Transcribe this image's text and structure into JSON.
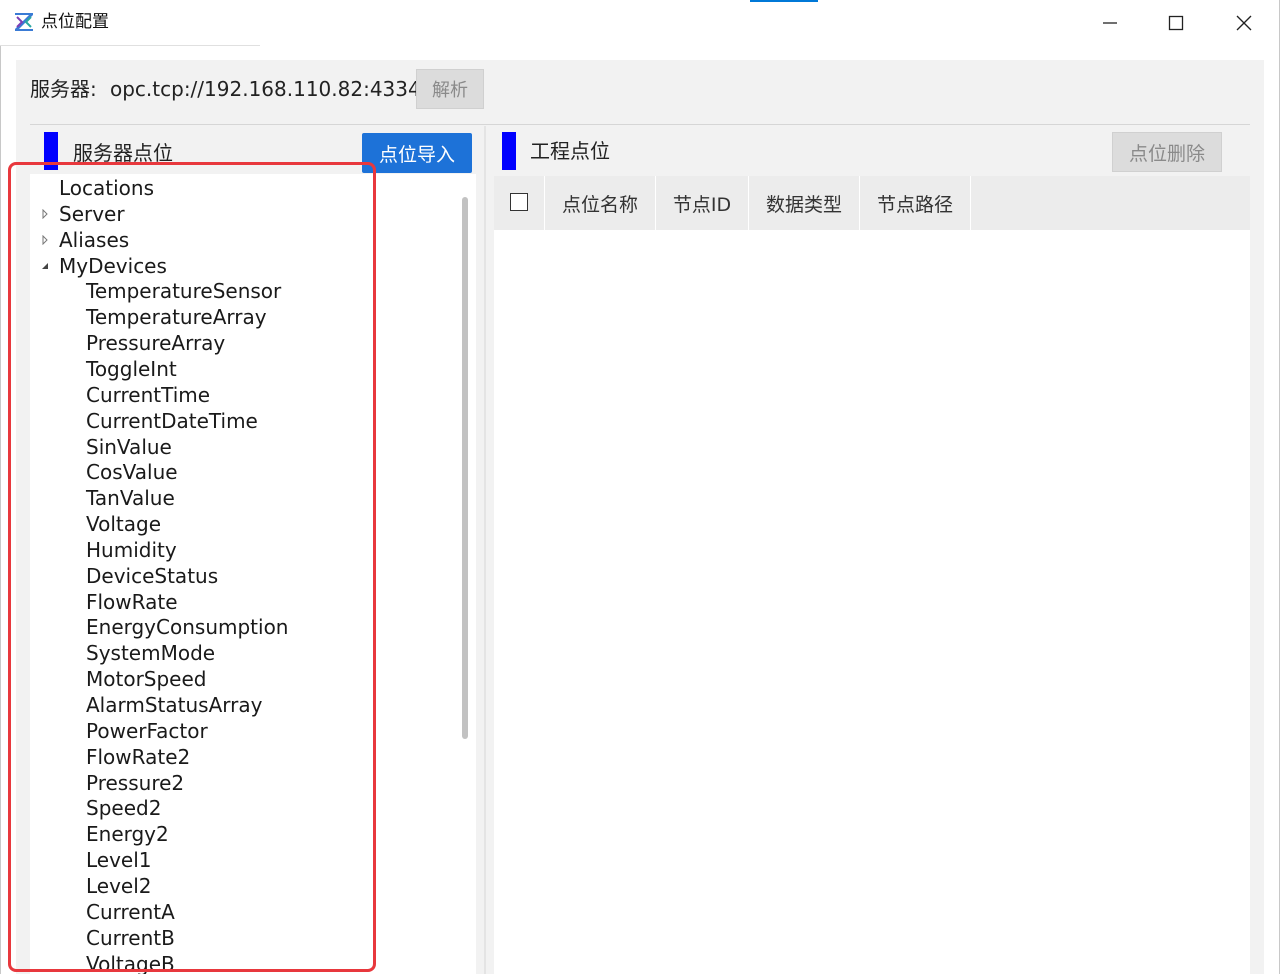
{
  "window": {
    "title": "点位配置",
    "icons": {
      "app": "app-logo-icon",
      "minimize": "minimize-icon",
      "maximize": "maximize-icon",
      "close": "close-icon"
    }
  },
  "server": {
    "label": "服务器:",
    "url": "opc.tcp://192.168.110.82:4334",
    "parse_button": "解析"
  },
  "left_panel": {
    "title": "服务器点位",
    "import_button": "点位导入",
    "tree": [
      {
        "label": "Locations",
        "level": 0,
        "arrow": "none"
      },
      {
        "label": "Server",
        "level": 0,
        "arrow": "collapsed"
      },
      {
        "label": "Aliases",
        "level": 0,
        "arrow": "collapsed"
      },
      {
        "label": "MyDevices",
        "level": 0,
        "arrow": "expanded"
      },
      {
        "label": "TemperatureSensor",
        "level": 1,
        "arrow": "none"
      },
      {
        "label": "TemperatureArray",
        "level": 1,
        "arrow": "none"
      },
      {
        "label": "PressureArray",
        "level": 1,
        "arrow": "none"
      },
      {
        "label": "ToggleInt",
        "level": 1,
        "arrow": "none"
      },
      {
        "label": "CurrentTime",
        "level": 1,
        "arrow": "none"
      },
      {
        "label": "CurrentDateTime",
        "level": 1,
        "arrow": "none"
      },
      {
        "label": "SinValue",
        "level": 1,
        "arrow": "none"
      },
      {
        "label": "CosValue",
        "level": 1,
        "arrow": "none"
      },
      {
        "label": "TanValue",
        "level": 1,
        "arrow": "none"
      },
      {
        "label": "Voltage",
        "level": 1,
        "arrow": "none"
      },
      {
        "label": "Humidity",
        "level": 1,
        "arrow": "none"
      },
      {
        "label": "DeviceStatus",
        "level": 1,
        "arrow": "none"
      },
      {
        "label": "FlowRate",
        "level": 1,
        "arrow": "none"
      },
      {
        "label": "EnergyConsumption",
        "level": 1,
        "arrow": "none"
      },
      {
        "label": "SystemMode",
        "level": 1,
        "arrow": "none"
      },
      {
        "label": "MotorSpeed",
        "level": 1,
        "arrow": "none"
      },
      {
        "label": "AlarmStatusArray",
        "level": 1,
        "arrow": "none"
      },
      {
        "label": "PowerFactor",
        "level": 1,
        "arrow": "none"
      },
      {
        "label": "FlowRate2",
        "level": 1,
        "arrow": "none"
      },
      {
        "label": "Pressure2",
        "level": 1,
        "arrow": "none"
      },
      {
        "label": "Speed2",
        "level": 1,
        "arrow": "none"
      },
      {
        "label": "Energy2",
        "level": 1,
        "arrow": "none"
      },
      {
        "label": "Level1",
        "level": 1,
        "arrow": "none"
      },
      {
        "label": "Level2",
        "level": 1,
        "arrow": "none"
      },
      {
        "label": "CurrentA",
        "level": 1,
        "arrow": "none"
      },
      {
        "label": "CurrentB",
        "level": 1,
        "arrow": "none"
      },
      {
        "label": "VoltageB",
        "level": 1,
        "arrow": "none"
      }
    ]
  },
  "right_panel": {
    "title": "工程点位",
    "delete_button": "点位删除",
    "columns": [
      "点位名称",
      "节点ID",
      "数据类型",
      "节点路径"
    ],
    "rows": []
  },
  "colors": {
    "accent_marker": "#0000ff",
    "primary_button": "#1d72d8",
    "highlight": "#e8383d",
    "panel_bg": "#f2f2f2",
    "header_bg": "#ececec"
  }
}
